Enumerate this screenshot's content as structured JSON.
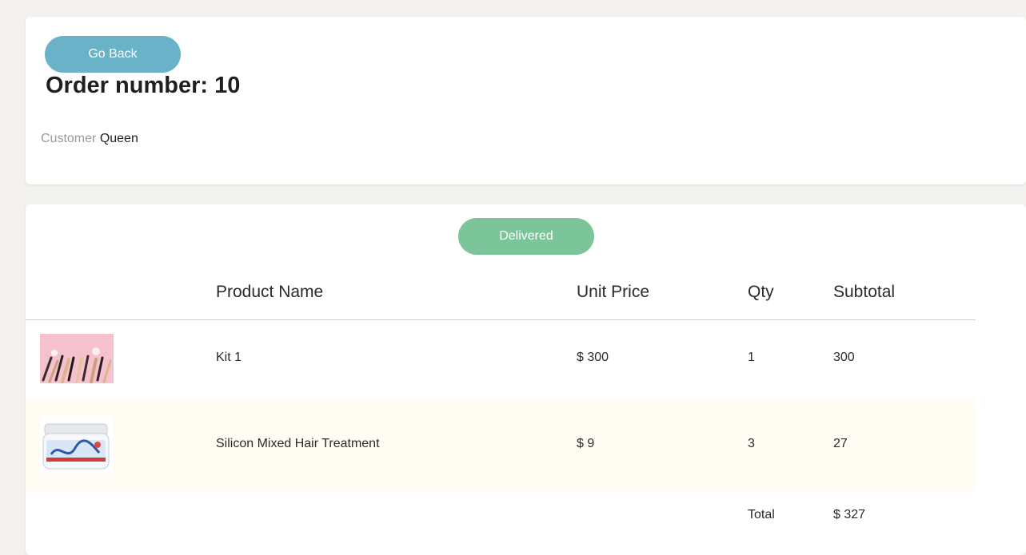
{
  "header": {
    "back_label": "Go Back",
    "order_title": "Order number: 10",
    "customer_label": "Customer",
    "customer_name": "Queen"
  },
  "order": {
    "status": "Delivered",
    "columns": {
      "name": "Product Name",
      "price": "Unit Price",
      "qty": "Qty",
      "subtotal": "Subtotal"
    },
    "items": [
      {
        "name": "Kit 1",
        "price": "$ 300",
        "qty": "1",
        "subtotal": "300",
        "image": "beauty-kit-photo"
      },
      {
        "name": "Silicon Mixed Hair Treatment",
        "price": "$ 9",
        "qty": "3",
        "subtotal": "27",
        "image": "hair-treatment-jar-photo"
      }
    ],
    "total_label": "Total",
    "total_value": "$ 327"
  },
  "colors": {
    "page_bg": "#f3f2ef",
    "back_button": "#6ab2c8",
    "status_delivered": "#7cc49a",
    "alt_row": "#fffcf3"
  }
}
